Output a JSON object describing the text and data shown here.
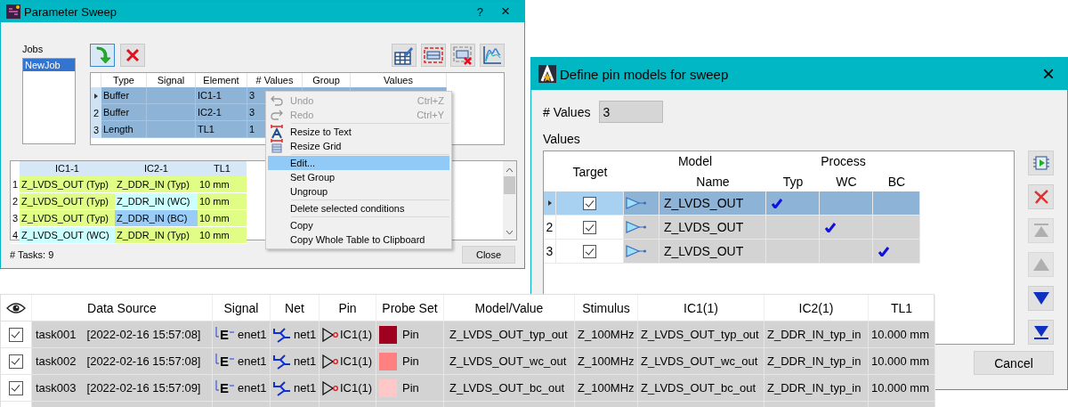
{
  "sweep_window": {
    "title": "Parameter Sweep",
    "help": "?",
    "close": "×",
    "jobs_label": "Jobs",
    "jobs": [
      {
        "label": "NewJob",
        "selected": true
      }
    ],
    "toolbar_left": [
      {
        "kind": "add"
      },
      {
        "kind": "delete"
      }
    ],
    "toolbar_right": [
      {
        "kind": "edit-table"
      },
      {
        "kind": "select-rows"
      },
      {
        "kind": "delete-rows"
      },
      {
        "kind": "waveform"
      }
    ],
    "conditions": {
      "columns": [
        "Type",
        "Signal",
        "Element",
        "# Values",
        "Group",
        "Values"
      ],
      "rows": [
        {
          "current": true,
          "selected": true,
          "type": "Buffer",
          "element": "IC1-1",
          "count": "3"
        },
        {
          "label": "2",
          "current": false,
          "selected": true,
          "type": "Buffer",
          "element": "IC2-1",
          "count": "3"
        },
        {
          "label": "3",
          "current": false,
          "selected": true,
          "type": "Length",
          "element": "TL1",
          "count": "1"
        }
      ]
    },
    "tasks": {
      "columns": [
        "IC1-1",
        "IC2-1",
        "TL1"
      ],
      "rows": [
        {
          "label": "1",
          "cells": [
            {
              "text": "Z_LVDS_OUT (Typ)",
              "color": "#e0fd86"
            },
            {
              "text": "Z_DDR_IN (Typ)",
              "color": "#e0fd86"
            },
            {
              "text": "10 mm",
              "color": "#e0fd86"
            }
          ]
        },
        {
          "label": "2",
          "cells": [
            {
              "text": "Z_LVDS_OUT (Typ)",
              "color": "#e0fd86"
            },
            {
              "text": "Z_DDR_IN (WC)",
              "color": "#ccffff"
            },
            {
              "text": "10 mm",
              "color": "#e0fd86"
            }
          ]
        },
        {
          "label": "3",
          "cells": [
            {
              "text": "Z_LVDS_OUT (Typ)",
              "color": "#e0fd86"
            },
            {
              "text": "Z_DDR_IN (BC)",
              "color": "#99ccf8"
            },
            {
              "text": "10 mm",
              "color": "#e0fd86"
            }
          ]
        },
        {
          "label": "4",
          "cells": [
            {
              "text": "Z_LVDS_OUT (WC)",
              "color": "#ccffff"
            },
            {
              "text": "Z_DDR_IN (Typ)",
              "color": "#e0fd86"
            },
            {
              "text": "10 mm",
              "color": "#e0fd86"
            }
          ]
        }
      ]
    },
    "task_count": "# Tasks: 9",
    "close_button": "Close"
  },
  "context_menu": {
    "items": [
      {
        "kind": "undo",
        "label": "Undo",
        "shortcut": "Ctrl+Z",
        "disabled": true,
        "selected": false
      },
      {
        "kind": "redo",
        "label": "Redo",
        "shortcut": "Ctrl+Y",
        "disabled": true,
        "selected": false
      },
      {
        "kind": "separator"
      },
      {
        "kind": "resize-text",
        "label": "Resize to Text",
        "disabled": false,
        "selected": false
      },
      {
        "kind": "resize-grid",
        "label": "Resize Grid",
        "disabled": false,
        "selected": false
      },
      {
        "kind": "separator"
      },
      {
        "kind": "plain",
        "label": "Edit...",
        "disabled": false,
        "selected": true
      },
      {
        "kind": "plain",
        "label": "Set Group",
        "disabled": false,
        "selected": false
      },
      {
        "kind": "plain",
        "label": "Ungroup",
        "disabled": false,
        "selected": false
      },
      {
        "kind": "separator"
      },
      {
        "kind": "plain",
        "label": "Delete selected conditions",
        "disabled": false,
        "selected": false
      },
      {
        "kind": "separator"
      },
      {
        "kind": "plain",
        "label": "Copy",
        "disabled": false,
        "selected": false
      },
      {
        "kind": "plain",
        "label": "Copy Whole Table to Clipboard",
        "disabled": false,
        "selected": false
      }
    ]
  },
  "pin_dialog": {
    "title": "Define pin models for sweep",
    "close": "×",
    "count_label": "# Values",
    "count_value": "3",
    "values_label": "Values",
    "table": {
      "target_header": "Target",
      "model_header": "Model",
      "name_header": "Name",
      "process_header": "Process",
      "process_columns": [
        "Typ",
        "WC",
        "BC"
      ],
      "rows": [
        {
          "current": true,
          "selected": true,
          "target": true,
          "name": "Z_LVDS_OUT",
          "process": [
            true,
            false,
            false
          ]
        },
        {
          "label": "2",
          "current": false,
          "selected": false,
          "target": true,
          "name": "Z_LVDS_OUT",
          "process": [
            false,
            true,
            false
          ]
        },
        {
          "label": "3",
          "current": false,
          "selected": false,
          "target": true,
          "name": "Z_LVDS_OUT",
          "process": [
            false,
            false,
            true
          ]
        }
      ]
    },
    "side_buttons": [
      {
        "kind": "run",
        "disabled": false
      },
      {
        "kind": "delete",
        "disabled": false
      },
      {
        "kind": "top",
        "disabled": true
      },
      {
        "kind": "up",
        "disabled": true
      },
      {
        "kind": "down",
        "disabled": false
      },
      {
        "kind": "bottom",
        "disabled": false
      }
    ],
    "cancel_button": "Cancel"
  },
  "results": {
    "columns": [
      "Data Source",
      "Signal",
      "Net",
      "Pin",
      "Probe Set",
      "Model/Value",
      "Stimulus",
      "IC1(1)",
      "IC2(1)",
      "TL1"
    ],
    "rows": [
      {
        "checked": true,
        "task": "task001",
        "time": "[2022-02-16 15:57:08]",
        "signal_mark": "E",
        "signal": "enet1",
        "net": "net1",
        "pin": "IC1(1)",
        "color": "#a00020",
        "probe": "Pin",
        "model": "Z_LVDS_OUT_typ_out",
        "stimulus": "Z_100MHz",
        "ic1": "Z_LVDS_OUT_typ_out",
        "ic2": "Z_DDR_IN_typ_in",
        "tl1": "10.000 mm"
      },
      {
        "checked": true,
        "task": "task002",
        "time": "[2022-02-16 15:57:08]",
        "signal_mark": "E",
        "signal": "enet1",
        "net": "net1",
        "pin": "IC1(1)",
        "color": "#ff8080",
        "probe": "Pin",
        "model": "Z_LVDS_OUT_wc_out",
        "stimulus": "Z_100MHz",
        "ic1": "Z_LVDS_OUT_wc_out",
        "ic2": "Z_DDR_IN_typ_in",
        "tl1": "10.000 mm"
      },
      {
        "checked": true,
        "task": "task003",
        "time": "[2022-02-16 15:57:09]",
        "signal_mark": "E",
        "signal": "enet1",
        "net": "net1",
        "pin": "IC1(1)",
        "color": "#ffc8c8",
        "probe": "Pin",
        "model": "Z_LVDS_OUT_bc_out",
        "stimulus": "Z_100MHz",
        "ic1": "Z_LVDS_OUT_bc_out",
        "ic2": "Z_DDR_IN_typ_in",
        "tl1": "10.000 mm"
      }
    ]
  }
}
